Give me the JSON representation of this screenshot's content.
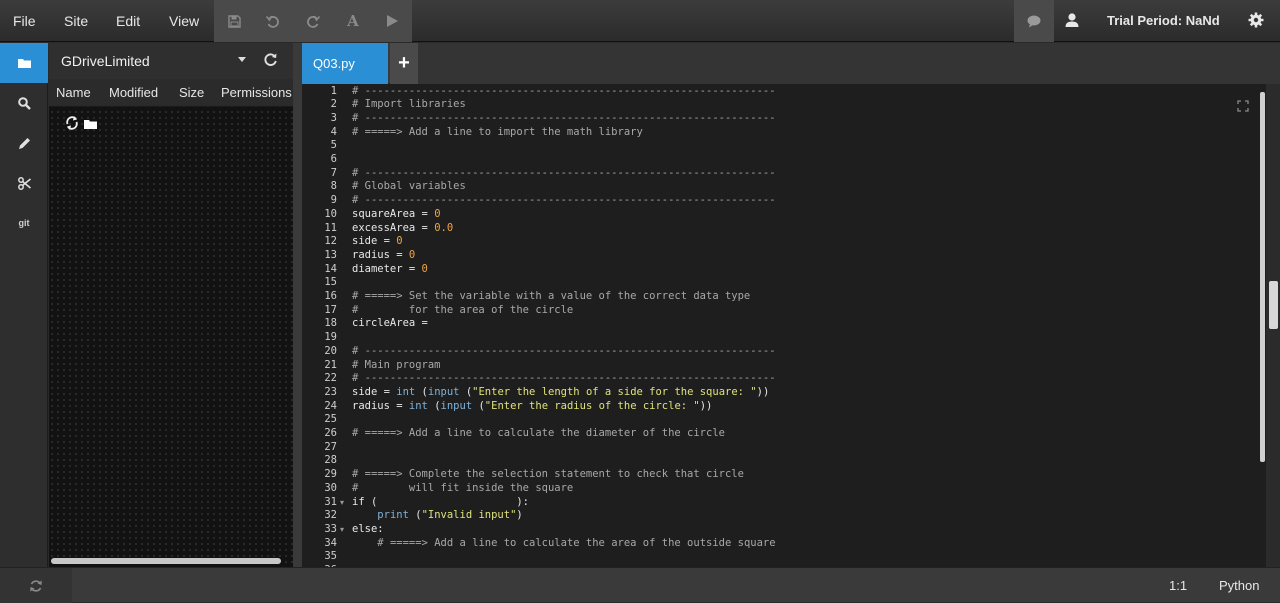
{
  "menubar": {
    "items": [
      "File",
      "Site",
      "Edit",
      "View"
    ],
    "toolbar": {
      "font_label": "A"
    },
    "trial_label": "Trial Period: NaNd"
  },
  "file_panel": {
    "drive_name": "GDriveLimited",
    "columns": [
      "Name",
      "Modified",
      "Size",
      "Permissions"
    ]
  },
  "tabs": {
    "active": "Q03.py",
    "add_label": "+"
  },
  "rail": {
    "git_label": "git"
  },
  "editor": {
    "lines": [
      "# -----------------------------------------------------------------",
      "# Import libraries",
      "# -----------------------------------------------------------------",
      "# =====> Add a line to import the math library",
      "",
      "",
      "# -----------------------------------------------------------------",
      "# Global variables",
      "# -----------------------------------------------------------------",
      "squareArea = 0",
      "excessArea = 0.0",
      "side = 0",
      "radius = 0",
      "diameter = 0",
      "",
      "# =====> Set the variable with a value of the correct data type",
      "#        for the area of the circle",
      "circleArea =",
      "",
      "# -----------------------------------------------------------------",
      "# Main program",
      "# -----------------------------------------------------------------",
      "side = int (input (\"Enter the length of a side for the square: \"))",
      "radius = int (input (\"Enter the radius of the circle: \"))",
      "",
      "# =====> Add a line to calculate the diameter of the circle",
      "",
      "",
      "# =====> Complete the selection statement to check that circle",
      "#        will fit inside the square",
      "if (                      ):",
      "    print (\"Invalid input\")",
      "else:",
      "    # =====> Add a line to calculate the area of the outside square",
      "",
      ""
    ],
    "fold_lines": [
      31,
      33
    ]
  },
  "status": {
    "position": "1:1",
    "language": "Python"
  }
}
